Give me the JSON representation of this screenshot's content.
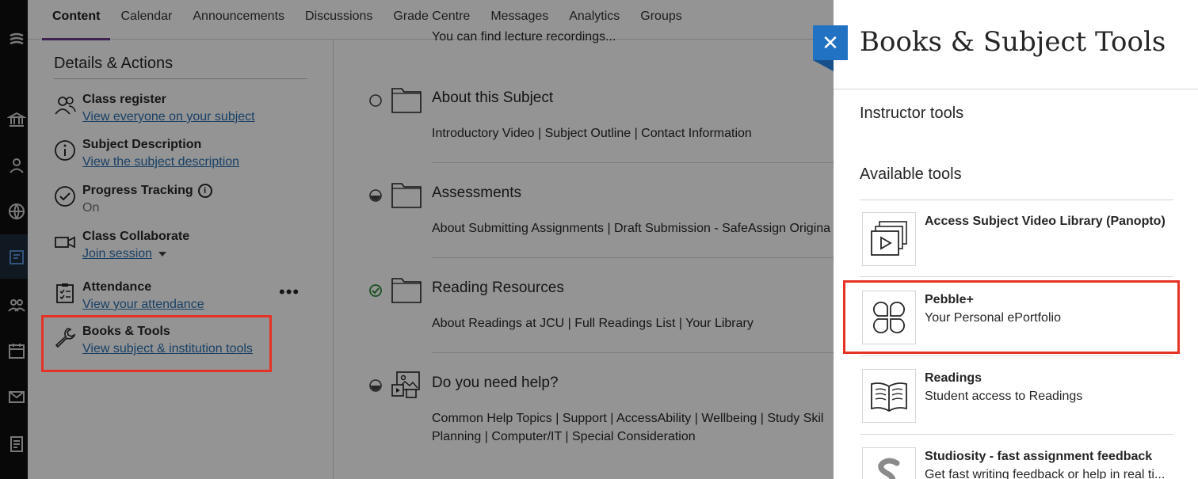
{
  "tabs": [
    {
      "label": "Content",
      "active": true
    },
    {
      "label": "Calendar"
    },
    {
      "label": "Announcements"
    },
    {
      "label": "Discussions"
    },
    {
      "label": "Grade Centre"
    },
    {
      "label": "Messages"
    },
    {
      "label": "Analytics"
    },
    {
      "label": "Groups"
    }
  ],
  "details": {
    "title": "Details & Actions",
    "items": [
      {
        "icon": "people-icon",
        "label": "Class register",
        "link": "View everyone on your subject"
      },
      {
        "icon": "info-icon",
        "label": "Subject Description",
        "link": "View the subject description"
      },
      {
        "icon": "check-circle-icon",
        "label": "Progress Tracking",
        "sub": "On"
      },
      {
        "icon": "video-icon",
        "label": "Class Collaborate",
        "link": "Join session"
      },
      {
        "icon": "clipboard-icon",
        "label": "Attendance",
        "link": "View your attendance"
      },
      {
        "icon": "wrench-icon",
        "label": "Books & Tools",
        "link": "View subject & institution tools"
      }
    ],
    "more_label": "•••"
  },
  "content": {
    "top_text": "You can find lecture recordings...",
    "folders": [
      {
        "title": "About this Subject",
        "links": "Introductory Video | Subject Outline | Contact Information",
        "status": "empty"
      },
      {
        "title": "Assessments",
        "links": "About Submitting Assignments | Draft Submission - SafeAssign Origina",
        "status": "half"
      },
      {
        "title": "Reading Resources",
        "links": "About Readings at JCU | Full Readings List | Your Library",
        "status": "done"
      },
      {
        "title": "Do you need help?",
        "links": "Common Help Topics | Support | AccessAbility | Wellbeing | Study Skil",
        "links2": "Planning | Computer/IT | Special Consideration",
        "status": "half"
      }
    ]
  },
  "panel": {
    "title": "Books & Subject Tools",
    "close_label": "✕",
    "instructor_heading": "Instructor tools",
    "available_heading": "Available tools",
    "tools": [
      {
        "icon": "video-library-icon",
        "name": "Access Subject Video Library (Panopto)",
        "desc": ""
      },
      {
        "icon": "pebble-icon",
        "name": "Pebble+",
        "desc": "Your Personal ePortfolio"
      },
      {
        "icon": "book-icon",
        "name": "Readings",
        "desc": "Student access to Readings"
      },
      {
        "icon": "studiosity-icon",
        "name": "Studiosity - fast assignment feedback",
        "desc": "Get fast writing feedback or help in real ti..."
      }
    ]
  },
  "colors": {
    "accent_tab": "#6e3c8c",
    "link": "#2a6fb0",
    "close_button": "#2272c4",
    "highlight": "#e53224",
    "status_done": "#2e8b3a"
  }
}
